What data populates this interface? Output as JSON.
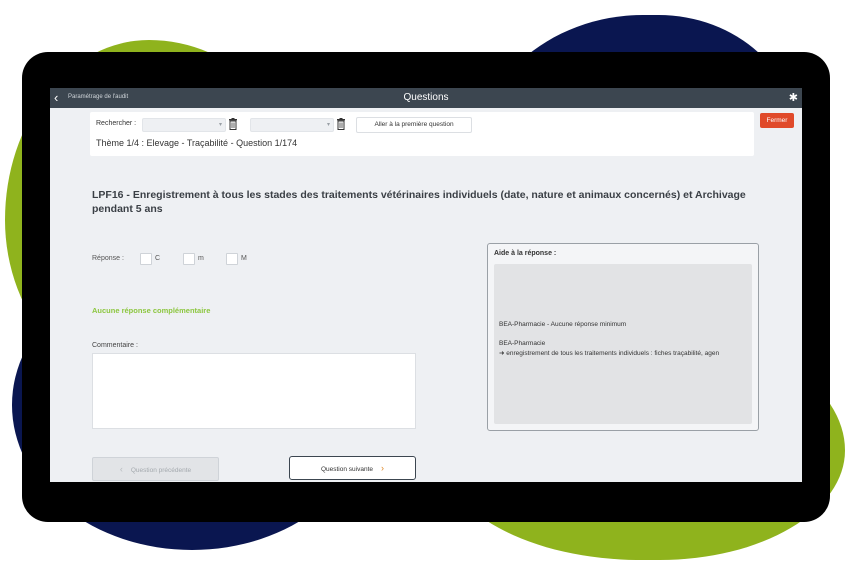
{
  "topbar": {
    "back_label": "Paramétrage de l'audit",
    "title": "Questions",
    "icons": {
      "back": "chevron-left-icon",
      "settings": "gear-icon"
    }
  },
  "search": {
    "label": "Rechercher :",
    "select1_value": "",
    "select2_value": "",
    "goto_first_label": "Aller à la première question",
    "theme_line": "Thème 1/4 : Elevage - Traçabilité - Question 1/174"
  },
  "close_label": "Fermer",
  "question": {
    "text": "LPF16 - Enregistrement à tous les stades des traitements vétérinaires individuels (date, nature et animaux concernés) et Archivage pendant 5 ans"
  },
  "response": {
    "label": "Réponse :",
    "options": [
      "C",
      "m",
      "M"
    ]
  },
  "aucune_label": "Aucune réponse complémentaire",
  "comment": {
    "label": "Commentaire :",
    "value": ""
  },
  "aide": {
    "title": "Aide à la réponse :",
    "line1": "BEA-Pharmacie - Aucune réponse minimum",
    "line2": "BEA-Pharmacie",
    "line3": "➜ enregistrement de tous les traitements individuels : fiches traçabilité, agen"
  },
  "nav": {
    "prev_label": "Question précédente",
    "next_label": "Question suivante"
  },
  "colors": {
    "accent_green": "#8cc63f",
    "brand_navy": "#0a1650",
    "close_red": "#e04a2a",
    "topbar": "#3c4650"
  }
}
